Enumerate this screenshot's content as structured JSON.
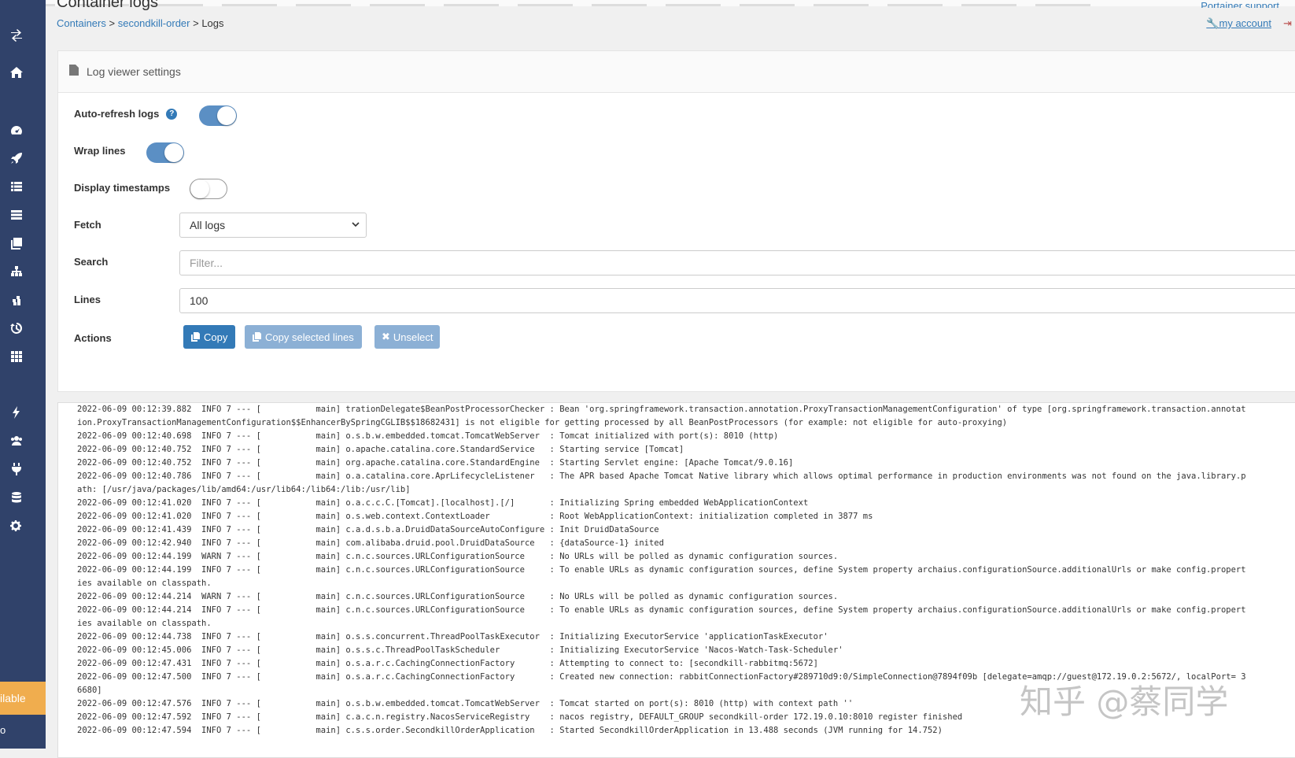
{
  "header": {
    "title": "Container logs",
    "breadcrumb": {
      "containers": "Containers",
      "sep1": ">",
      "container": "secondkill-order",
      "sep2": ">",
      "current": "Logs"
    },
    "support_label": "Portainer support",
    "account_label": "my account"
  },
  "sidebar": {
    "badge_label": "ilable",
    "bottom_label": "o",
    "icons": [
      "toggle-icon",
      "home-icon",
      "dashboard-icon",
      "app-templates-icon",
      "stacks-icon",
      "containers-icon",
      "images-icon",
      "networks-icon",
      "volumes-icon",
      "events-icon",
      "host-icon",
      "extensions-icon",
      "users-icon",
      "endpoints-icon",
      "registries-icon",
      "settings-icon"
    ]
  },
  "settings": {
    "panel_title": "Log viewer settings",
    "auto_refresh_label": "Auto-refresh logs",
    "auto_refresh": true,
    "wrap_lines_label": "Wrap lines",
    "wrap_lines": true,
    "timestamps_label": "Display timestamps",
    "timestamps": false,
    "fetch_label": "Fetch",
    "fetch_value": "All logs",
    "search_label": "Search",
    "search_placeholder": "Filter...",
    "lines_label": "Lines",
    "lines_value": "100",
    "actions_label": "Actions",
    "copy_label": "Copy",
    "copy_selected_label": "Copy selected lines",
    "unselect_label": "Unselect"
  },
  "logs": [
    "2022-06-09 00:12:39.882  INFO 7 --- [           main] trationDelegate$BeanPostProcessorChecker : Bean 'org.springframework.transaction.annotation.ProxyTransactionManagementConfiguration' of type [org.springframework.transaction.annotat",
    "ion.ProxyTransactionManagementConfiguration$$EnhancerBySpringCGLIB$$18682431] is not eligible for getting processed by all BeanPostProcessors (for example: not eligible for auto-proxying)",
    "2022-06-09 00:12:40.698  INFO 7 --- [           main] o.s.b.w.embedded.tomcat.TomcatWebServer  : Tomcat initialized with port(s): 8010 (http)",
    "2022-06-09 00:12:40.752  INFO 7 --- [           main] o.apache.catalina.core.StandardService   : Starting service [Tomcat]",
    "2022-06-09 00:12:40.752  INFO 7 --- [           main] org.apache.catalina.core.StandardEngine  : Starting Servlet engine: [Apache Tomcat/9.0.16]",
    "2022-06-09 00:12:40.786  INFO 7 --- [           main] o.a.catalina.core.AprLifecycleListener   : The APR based Apache Tomcat Native library which allows optimal performance in production environments was not found on the java.library.p",
    "ath: [/usr/java/packages/lib/amd64:/usr/lib64:/lib64:/lib:/usr/lib]",
    "2022-06-09 00:12:41.020  INFO 7 --- [           main] o.a.c.c.C.[Tomcat].[localhost].[/]       : Initializing Spring embedded WebApplicationContext",
    "2022-06-09 00:12:41.020  INFO 7 --- [           main] o.s.web.context.ContextLoader            : Root WebApplicationContext: initialization completed in 3877 ms",
    "2022-06-09 00:12:41.439  INFO 7 --- [           main] c.a.d.s.b.a.DruidDataSourceAutoConfigure : Init DruidDataSource",
    "2022-06-09 00:12:42.940  INFO 7 --- [           main] com.alibaba.druid.pool.DruidDataSource   : {dataSource-1} inited",
    "2022-06-09 00:12:44.199  WARN 7 --- [           main] c.n.c.sources.URLConfigurationSource     : No URLs will be polled as dynamic configuration sources.",
    "2022-06-09 00:12:44.199  INFO 7 --- [           main] c.n.c.sources.URLConfigurationSource     : To enable URLs as dynamic configuration sources, define System property archaius.configurationSource.additionalUrls or make config.propert",
    "ies available on classpath.",
    "2022-06-09 00:12:44.214  WARN 7 --- [           main] c.n.c.sources.URLConfigurationSource     : No URLs will be polled as dynamic configuration sources.",
    "2022-06-09 00:12:44.214  INFO 7 --- [           main] c.n.c.sources.URLConfigurationSource     : To enable URLs as dynamic configuration sources, define System property archaius.configurationSource.additionalUrls or make config.propert",
    "ies available on classpath.",
    "2022-06-09 00:12:44.738  INFO 7 --- [           main] o.s.s.concurrent.ThreadPoolTaskExecutor  : Initializing ExecutorService 'applicationTaskExecutor'",
    "2022-06-09 00:12:45.006  INFO 7 --- [           main] o.s.s.c.ThreadPoolTaskScheduler          : Initializing ExecutorService 'Nacos-Watch-Task-Scheduler'",
    "2022-06-09 00:12:47.431  INFO 7 --- [           main] o.s.a.r.c.CachingConnectionFactory       : Attempting to connect to: [secondkill-rabbitmq:5672]",
    "2022-06-09 00:12:47.500  INFO 7 --- [           main] o.s.a.r.c.CachingConnectionFactory       : Created new connection: rabbitConnectionFactory#289710d9:0/SimpleConnection@7894f09b [delegate=amqp://guest@172.19.0.2:5672/, localPort= 3",
    "6680]",
    "2022-06-09 00:12:47.576  INFO 7 --- [           main] o.s.b.w.embedded.tomcat.TomcatWebServer  : Tomcat started on port(s): 8010 (http) with context path ''",
    "2022-06-09 00:12:47.592  INFO 7 --- [           main] c.a.c.n.registry.NacosServiceRegistry    : nacos registry, DEFAULT_GROUP secondkill-order 172.19.0.10:8010 register finished",
    "2022-06-09 00:12:47.594  INFO 7 --- [           main] c.s.s.order.SecondkillOrderApplication   : Started SecondkillOrderApplication in 13.488 seconds (JVM running for 14.752)"
  ],
  "watermark": "知乎 @蔡同学"
}
